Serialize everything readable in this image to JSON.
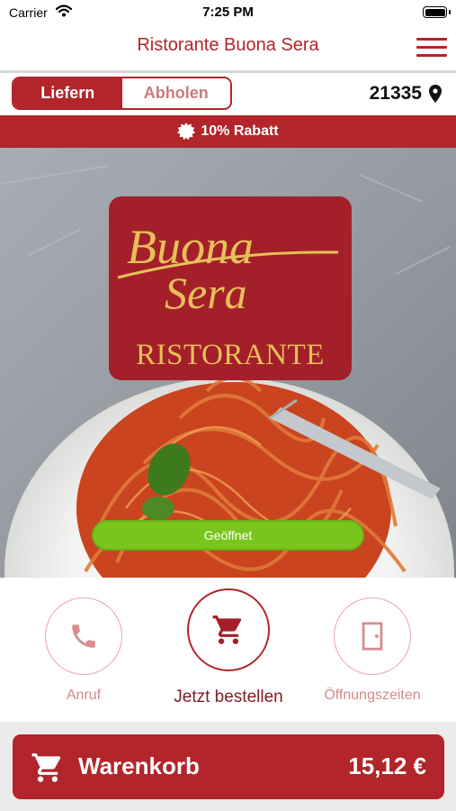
{
  "status_bar": {
    "carrier": "Carrier",
    "time": "7:25 PM"
  },
  "nav": {
    "title": "Ristorante Buona Sera",
    "menu_icon": "hamburger-menu-icon"
  },
  "order_mode": {
    "options": [
      "Liefern",
      "Abholen"
    ],
    "selected": "Liefern"
  },
  "location": {
    "zip": "21335",
    "icon": "location-pin-icon"
  },
  "discount": {
    "text": "10% Rabatt",
    "icon": "badge-star-icon"
  },
  "logo": {
    "script_line1": "Buona",
    "script_line2": "Sera",
    "subtitle": "RISTORANTE"
  },
  "status_badge": {
    "label": "Geöffnet",
    "color": "#79c41d"
  },
  "actions": [
    {
      "label": "Anruf",
      "icon": "phone-icon"
    },
    {
      "label": "Jetzt bestellen",
      "icon": "cart-icon"
    },
    {
      "label": "Öffnungszeiten",
      "icon": "door-icon"
    }
  ],
  "cart": {
    "label": "Warenkorb",
    "total": "15,12 €",
    "icon": "cart-icon"
  },
  "colors": {
    "brand_red": "#b1252b",
    "logo_gold": "#e8bf5a",
    "open_green": "#79c41d"
  }
}
